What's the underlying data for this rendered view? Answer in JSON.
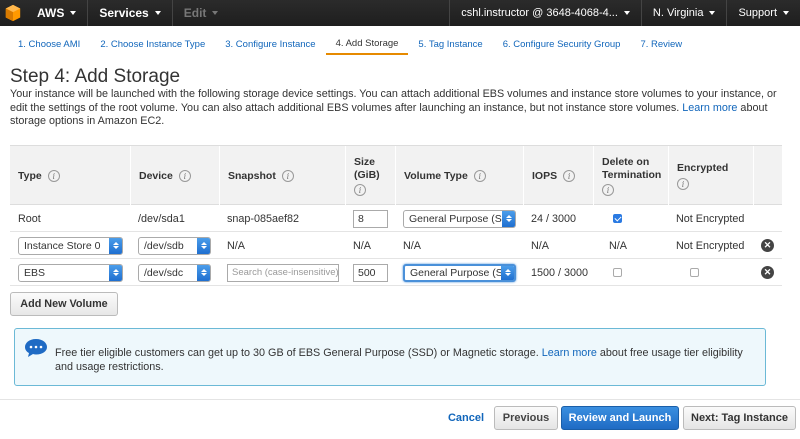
{
  "nav": {
    "aws": "AWS",
    "services": "Services",
    "edit": "Edit",
    "account": "cshl.instructor @ 3648-4068-4...",
    "region": "N. Virginia",
    "support": "Support"
  },
  "tabs": [
    {
      "label": "1. Choose AMI"
    },
    {
      "label": "2. Choose Instance Type"
    },
    {
      "label": "3. Configure Instance"
    },
    {
      "label": "4. Add Storage"
    },
    {
      "label": "5. Tag Instance"
    },
    {
      "label": "6. Configure Security Group"
    },
    {
      "label": "7. Review"
    }
  ],
  "page": {
    "title": "Step 4: Add Storage",
    "desc": "Your instance will be launched with the following storage device settings. You can attach additional EBS volumes and instance store volumes to your instance, or edit the settings of the root volume. You can also attach additional EBS volumes after launching an instance, but not instance store volumes. ",
    "learn_more": "Learn more",
    "desc_tail": " about storage options in Amazon EC2."
  },
  "table": {
    "headers": {
      "type": "Type",
      "device": "Device",
      "snapshot": "Snapshot",
      "size": "Size (GiB)",
      "volume_type": "Volume Type",
      "iops": "IOPS",
      "delete": "Delete on Termination",
      "encrypted": "Encrypted"
    },
    "rows": [
      {
        "type": "Root",
        "device": "/dev/sda1",
        "snapshot": "snap-085aef82",
        "size": "8",
        "volume_type": "General Purpose (SSD)",
        "iops": "24 / 3000",
        "delete_checked": true,
        "encrypted": "Not Encrypted"
      },
      {
        "type": "Instance Store 0",
        "device": "/dev/sdb",
        "snapshot": "N/A",
        "size": "N/A",
        "volume_type": "N/A",
        "iops": "N/A",
        "delete": "N/A",
        "encrypted": "Not Encrypted"
      },
      {
        "type": "EBS",
        "device": "/dev/sdc",
        "snapshot_placeholder": "Search (case-insensitive)",
        "size": "500",
        "volume_type": "General Purpose (SSD)",
        "iops": "1500 / 3000",
        "delete_checked": false,
        "encrypted_checked": false
      }
    ]
  },
  "add_volume": "Add New Volume",
  "notice": {
    "text": "Free tier eligible customers can get up to 30 GB of EBS General Purpose (SSD) or Magnetic storage. ",
    "link": "Learn more",
    "tail": " about free usage tier eligibility and usage restrictions."
  },
  "footer": {
    "cancel": "Cancel",
    "previous": "Previous",
    "review": "Review and Launch",
    "next": "Next: Tag Instance"
  },
  "colors": {
    "nav_bg": "#232f3e",
    "link": "#1166bb",
    "primary": "#1f6bc4",
    "tab_active": "#e68a00"
  }
}
